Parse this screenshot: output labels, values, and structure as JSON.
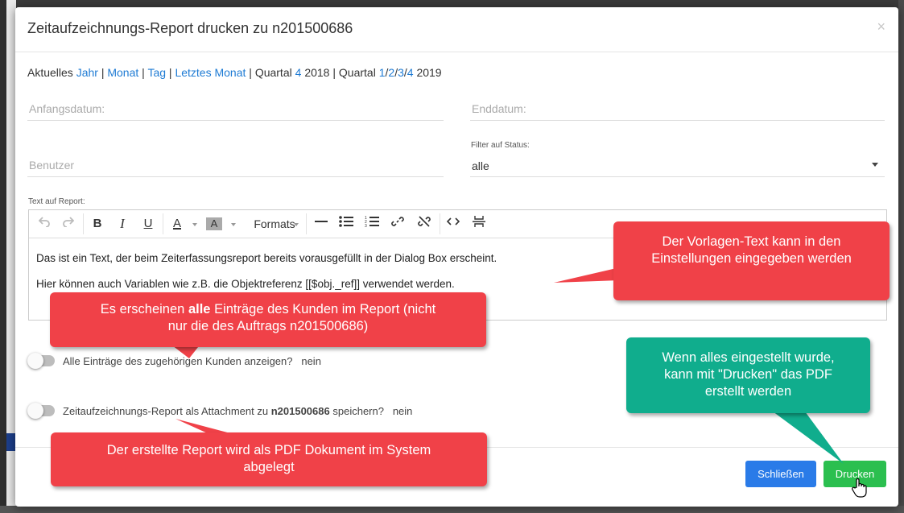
{
  "modal": {
    "title": "Zeitaufzeichnungs-Report drucken zu n201500686",
    "close_icon": "×"
  },
  "quick_links": {
    "prefix": "Aktuelles",
    "jahr": "Jahr",
    "sep": "|",
    "monat": "Monat",
    "tag": "Tag",
    "letztes_monat": "Letztes Monat",
    "quartal_label": "Quartal",
    "q2018_link": "4",
    "year_2018": "2018",
    "q2019_1": "1",
    "q2019_2": "2",
    "q2019_3": "3",
    "q2019_4": "4",
    "slash": "/",
    "year_2019": "2019"
  },
  "form": {
    "start_placeholder": "Anfangsdatum:",
    "end_placeholder": "Enddatum:",
    "user_placeholder": "Benutzer",
    "status_label": "Filter auf Status:",
    "status_value": "alle",
    "report_text_label": "Text auf Report:"
  },
  "editor": {
    "formats_label": "Formats",
    "line1": "Das ist ein Text, der beim Zeiterfassungsreport bereits vorausgefüllt in der Dialog Box erscheint.",
    "line2": "Hier können auch Variablen wie z.B. die Objektreferenz [[$obj._ref]] verwendet werden.",
    "icons": [
      "undo-icon",
      "redo-icon",
      "bold-icon",
      "italic-icon",
      "underline-icon",
      "text-color-icon",
      "background-color-icon",
      "horizontal-rule-icon",
      "bullet-list-icon",
      "numbered-list-icon",
      "link-icon",
      "unlink-icon",
      "source-code-icon",
      "page-break-icon"
    ]
  },
  "toggles": {
    "all_entries_label": "Alle Einträge des zugehörigen Kunden anzeigen?",
    "all_entries_value": "nein",
    "attachment_label_pre": "Zeitaufzeichnungs-Report als Attachment zu",
    "attachment_label_bold": "n201500686",
    "attachment_label_post": "speichern?",
    "attachment_value": "nein"
  },
  "buttons": {
    "close": "Schließen",
    "print": "Drucken"
  },
  "callouts": {
    "template_text": "Der Vorlagen-Text kann in den Einstellungen eingegeben werden",
    "all_pre": "Es erscheinen",
    "all_bold": "alle",
    "all_post": "Einträge des Kunden im Report (nicht nur die des Auftrags n201500686)",
    "print_hint": "Wenn alles eingestellt wurde, kann mit \"Drucken\" das PDF erstellt werden",
    "pdf_saved": "Der erstellte Report wird als PDF Dokument im System abgelegt"
  },
  "colors": {
    "link": "#1e7bd4",
    "callout_red": "#f04148",
    "callout_teal": "#10ad8d",
    "btn_blue": "#2a7be8",
    "btn_green": "#2bbf4f"
  }
}
